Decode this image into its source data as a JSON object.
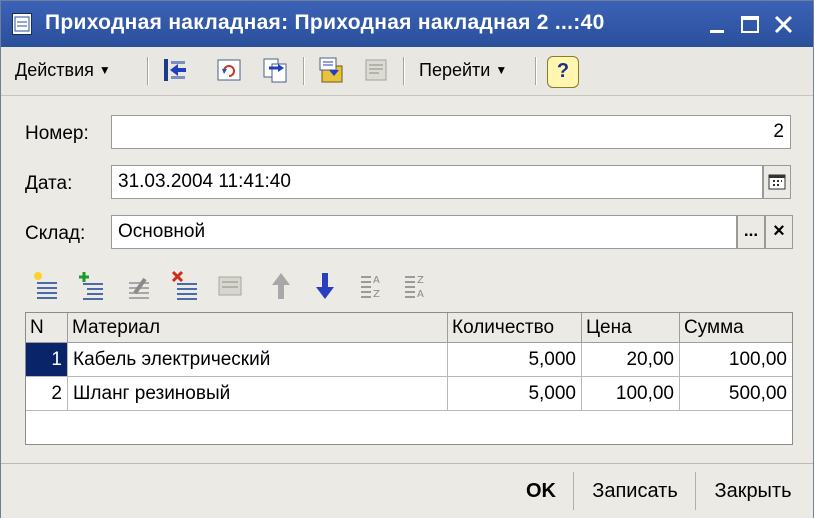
{
  "window": {
    "title": "Приходная накладная: Приходная накладная 2 ...:40"
  },
  "toolbar": {
    "actions_label": "Действия",
    "goto_label": "Перейти",
    "help_label": "?"
  },
  "form": {
    "number_label": "Номер:",
    "number_value": "2",
    "date_label": "Дата:",
    "date_value": "31.03.2004 11:41:40",
    "warehouse_label": "Склад:",
    "warehouse_value": "Основной",
    "select_btn": "...",
    "clear_btn": "×"
  },
  "table": {
    "headers": {
      "n": "N",
      "material": "Материал",
      "qty": "Количество",
      "price": "Цена",
      "sum": "Сумма"
    },
    "rows": [
      {
        "n": "1",
        "material": "Кабель электрический",
        "qty": "5,000",
        "price": "20,00",
        "sum": "100,00"
      },
      {
        "n": "2",
        "material": "Шланг резиновый",
        "qty": "5,000",
        "price": "100,00",
        "sum": "500,00"
      }
    ]
  },
  "footer": {
    "ok_label": "OK",
    "save_label": "Записать",
    "close_label": "Закрыть"
  },
  "colors": {
    "titlebar": "#2f56a8",
    "selection": "#0a246a",
    "accent_blue": "#1f3fbf"
  }
}
